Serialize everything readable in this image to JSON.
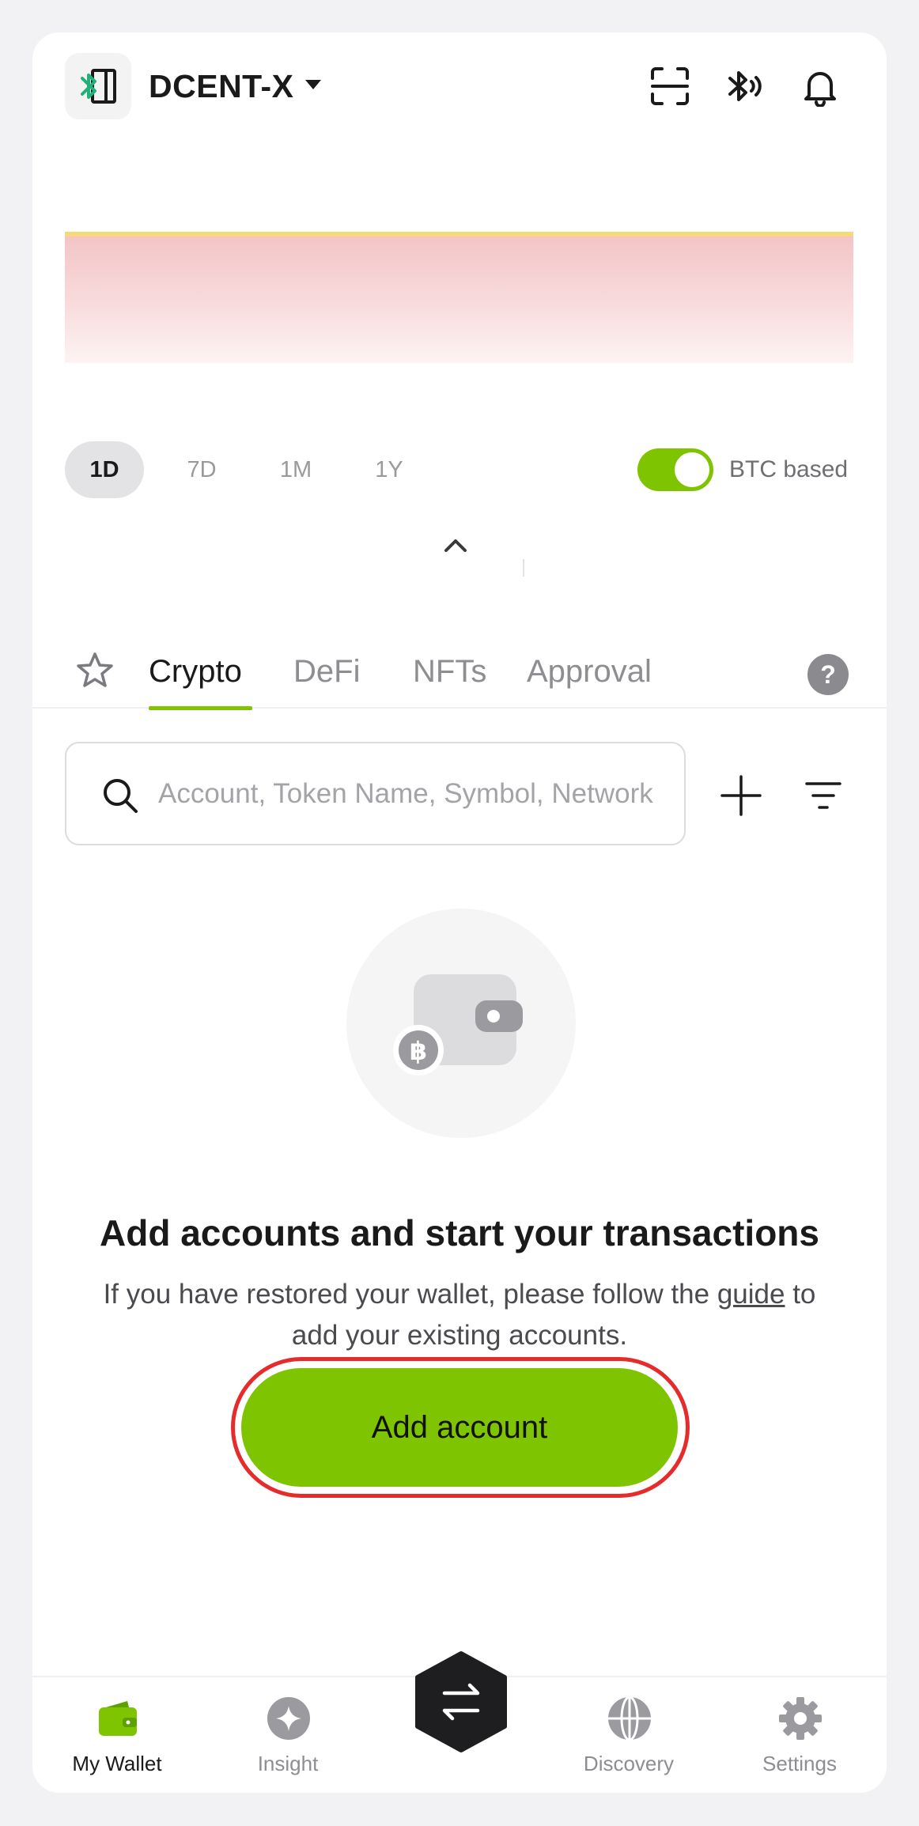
{
  "header": {
    "device_name": "DCENT-X",
    "icons": [
      "bluetooth-device-icon",
      "scan-icon",
      "bluetooth-icon",
      "bell-icon"
    ]
  },
  "period_selector": {
    "options": [
      "1D",
      "7D",
      "1M",
      "1Y"
    ],
    "selected": "1D"
  },
  "btc_toggle": {
    "label": "BTC based",
    "on": true
  },
  "tabs": {
    "items": [
      "Crypto",
      "DeFi",
      "NFTs",
      "Approval"
    ],
    "active": "Crypto",
    "help_label": "?"
  },
  "search": {
    "value": "",
    "placeholder": "Account, Token Name, Symbol, Network"
  },
  "empty_state": {
    "title": "Add accounts and start your transactions",
    "desc_before": "If you have restored your wallet, please follow the ",
    "link": "guide",
    "desc_after": " to add your existing accounts.",
    "button_label": "Add account"
  },
  "bottom_nav": {
    "items": [
      "My Wallet",
      "Insight",
      "Discovery",
      "Settings"
    ],
    "active": "My Wallet"
  },
  "colors": {
    "accent": "#7fc400",
    "highlight": "#e62b2b",
    "chart_line": "#f5d97a",
    "chart_fill": "#f4c4c6"
  }
}
